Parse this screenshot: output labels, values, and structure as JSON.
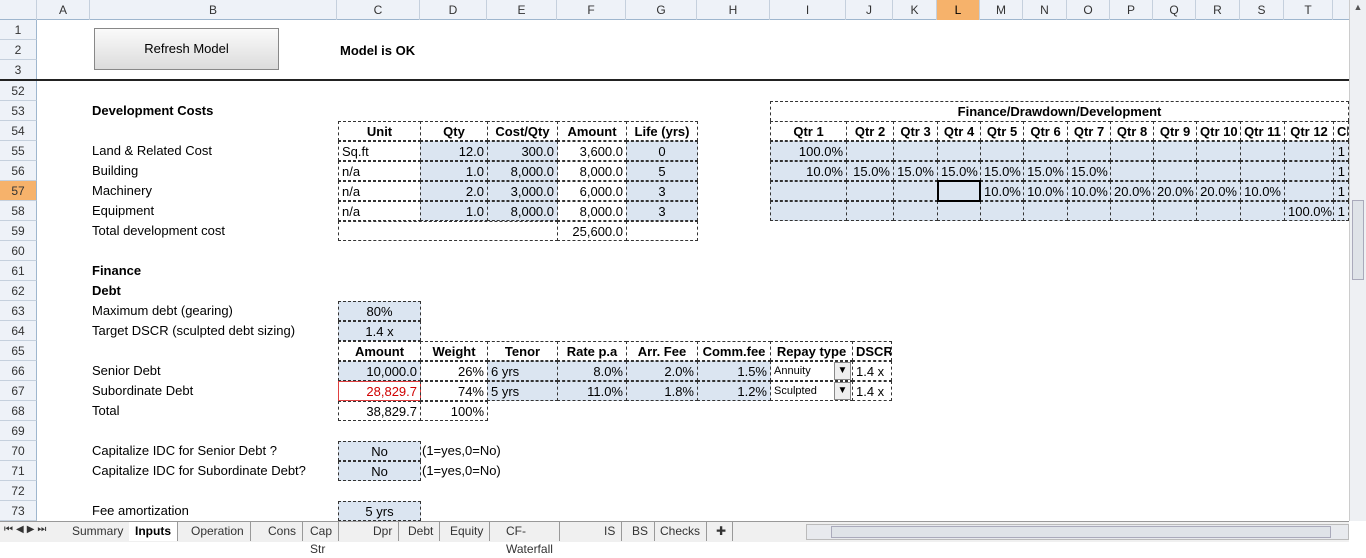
{
  "columns": [
    "A",
    "B",
    "C",
    "D",
    "E",
    "F",
    "G",
    "H",
    "I",
    "J",
    "K",
    "L",
    "M",
    "N",
    "O",
    "P",
    "Q",
    "R",
    "S",
    "T"
  ],
  "rows": [
    "1",
    "2",
    "3",
    "52",
    "53",
    "54",
    "55",
    "56",
    "57",
    "58",
    "59",
    "60",
    "61",
    "62",
    "63",
    "64",
    "65",
    "66",
    "67",
    "68",
    "69",
    "70",
    "71",
    "72",
    "73"
  ],
  "header": {
    "refresh_label": "Refresh Model",
    "status": "Model is OK"
  },
  "dev": {
    "title": "Development Costs",
    "headers": [
      "Unit",
      "Qty",
      "Cost/Qty",
      "Amount",
      "Life (yrs)"
    ],
    "rows": [
      {
        "name": "Land & Related Cost",
        "unit": "Sq.ft",
        "qty": "12.0",
        "cost": "300.0",
        "amount": "3,600.0",
        "life": "0"
      },
      {
        "name": "Building",
        "unit": "n/a",
        "qty": "1.0",
        "cost": "8,000.0",
        "amount": "8,000.0",
        "life": "5"
      },
      {
        "name": "Machinery",
        "unit": "n/a",
        "qty": "2.0",
        "cost": "3,000.0",
        "amount": "6,000.0",
        "life": "3"
      },
      {
        "name": "Equipment",
        "unit": "n/a",
        "qty": "1.0",
        "cost": "8,000.0",
        "amount": "8,000.0",
        "life": "3"
      }
    ],
    "total_label": "Total development cost",
    "total": "25,600.0"
  },
  "finance": {
    "title": "Finance/Drawdown/Development",
    "quarters": [
      "Qtr 1",
      "Qtr 2",
      "Qtr 3",
      "Qtr 4",
      "Qtr 5",
      "Qtr 6",
      "Qtr 7",
      "Qtr 8",
      "Qtr 9",
      "Qtr 10",
      "Qtr 11",
      "Qtr 12",
      "Ch"
    ],
    "rows": [
      [
        "100.0%",
        "",
        "",
        "",
        "",
        "",
        "",
        "",
        "",
        "",
        "",
        "",
        "1"
      ],
      [
        "10.0%",
        "15.0%",
        "15.0%",
        "15.0%",
        "15.0%",
        "15.0%",
        "15.0%",
        "",
        "",
        "",
        "",
        "",
        "1"
      ],
      [
        "",
        "",
        "",
        "",
        "10.0%",
        "10.0%",
        "10.0%",
        "20.0%",
        "20.0%",
        "20.0%",
        "10.0%",
        "",
        "1"
      ],
      [
        "",
        "",
        "",
        "",
        "",
        "",
        "",
        "",
        "",
        "",
        "",
        "100.0%",
        "1"
      ]
    ]
  },
  "debt": {
    "finance_label": "Finance",
    "debt_label": "Debt",
    "max_label": "Maximum debt (gearing)",
    "max": "80%",
    "dscr_label": "Target DSCR (sculpted debt sizing)",
    "dscr": "1.4 x",
    "headers": [
      "Amount",
      "Weight",
      "Tenor",
      "Rate p.a",
      "Arr. Fee",
      "Comm.fee",
      "Repay type",
      "DSCR"
    ],
    "rows": [
      {
        "name": "Senior Debt",
        "amount": "10,000.0",
        "weight": "26%",
        "tenor": "6 yrs",
        "rate": "8.0%",
        "arr": "2.0%",
        "comm": "1.5%",
        "repay": "Annuity",
        "dscr": "1.4 x"
      },
      {
        "name": "Subordinate Debt",
        "amount": "28,829.7",
        "weight": "74%",
        "tenor": "5 yrs",
        "rate": "11.0%",
        "arr": "1.8%",
        "comm": "1.2%",
        "repay": "Sculpted",
        "dscr": "1.4 x"
      }
    ],
    "total_label": "Total",
    "total_amount": "38,829.7",
    "total_weight": "100%",
    "cap_senior_label": "Capitalize IDC for Senior Debt ?",
    "cap_senior": "No",
    "cap_sub_label": "Capitalize IDC for Subordinate Debt?",
    "cap_sub": "No",
    "cap_hint": "(1=yes,0=No)",
    "fee_label": "Fee amortization",
    "fee": "5 yrs"
  },
  "tabs": [
    "Summary",
    "Inputs",
    "Operation",
    "Cons",
    "Cap Str",
    "Dpr",
    "Debt",
    "Equity",
    "CF-Waterfall",
    "IS",
    "BS",
    "Checks"
  ],
  "active_tab": "Inputs",
  "colors": {
    "input": "#dbe5f1",
    "selected_header": "#f6b26b",
    "error_border": "#e04040",
    "error_text": "#d00000"
  }
}
